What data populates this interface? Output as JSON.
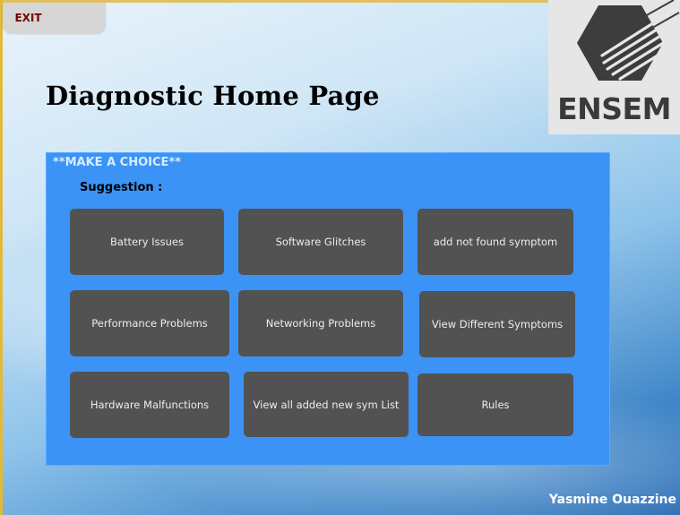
{
  "header": {
    "exit_label": "EXIT",
    "page_title": "Diagnostic Home Page"
  },
  "logo": {
    "text": "ENSEM"
  },
  "panel": {
    "title": "**MAKE A CHOICE**",
    "suggestion_label": "Suggestion :",
    "buttons": [
      {
        "label": "Battery Issues"
      },
      {
        "label": "Software Glitches"
      },
      {
        "label": "add not found symptom"
      },
      {
        "label": "Performance Problems"
      },
      {
        "label": "Networking Problems"
      },
      {
        "label": "View Different Symptoms"
      },
      {
        "label": "Hardware Malfunctions"
      },
      {
        "label": "View all added new  sym List"
      },
      {
        "label": "Rules"
      }
    ]
  },
  "footer": {
    "author": "Yasmine Ouazzine"
  },
  "colors": {
    "panel": "#3b93f5",
    "button": "#525252",
    "exit_text": "#7a0000"
  }
}
